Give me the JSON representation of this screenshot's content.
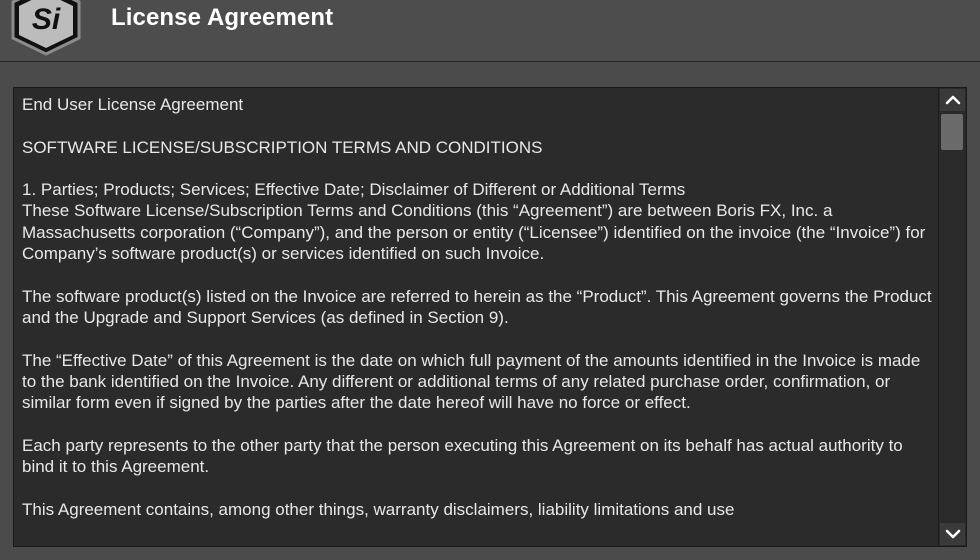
{
  "window": {
    "title": "License Agreement",
    "logo_text": "Si"
  },
  "license": {
    "paragraphs": [
      "End User License Agreement",
      "SOFTWARE LICENSE/SUBSCRIPTION TERMS AND CONDITIONS",
      "1. Parties; Products; Services; Effective Date; Disclaimer of Different or Additional Terms\nThese Software License/Subscription Terms and Conditions (this “Agreement”) are between Boris FX, Inc. a Massachusetts corporation (“Company”), and the person or entity (“Licensee”) identified on the invoice (the “Invoice”) for Company’s software product(s) or services identified on such Invoice.",
      "The software product(s) listed on the Invoice are referred to herein as the “Product”. This Agreement governs the Product and the Upgrade and Support Services (as defined in Section 9).",
      "The “Effective Date” of this Agreement is the date on which full payment of the amounts identified in the Invoice is made to the bank identified on the Invoice. Any different or additional terms of any related purchase order, confirmation, or similar form even if signed by the parties after the date hereof will have no force or effect.",
      "Each party represents to the other party that the person executing this Agreement on its behalf has actual authority to bind it to this Agreement.",
      "This Agreement contains, among other things, warranty disclaimers, liability limitations and use"
    ]
  },
  "scrollbar": {
    "up_icon": "chevron-up-icon",
    "down_icon": "chevron-down-icon"
  }
}
